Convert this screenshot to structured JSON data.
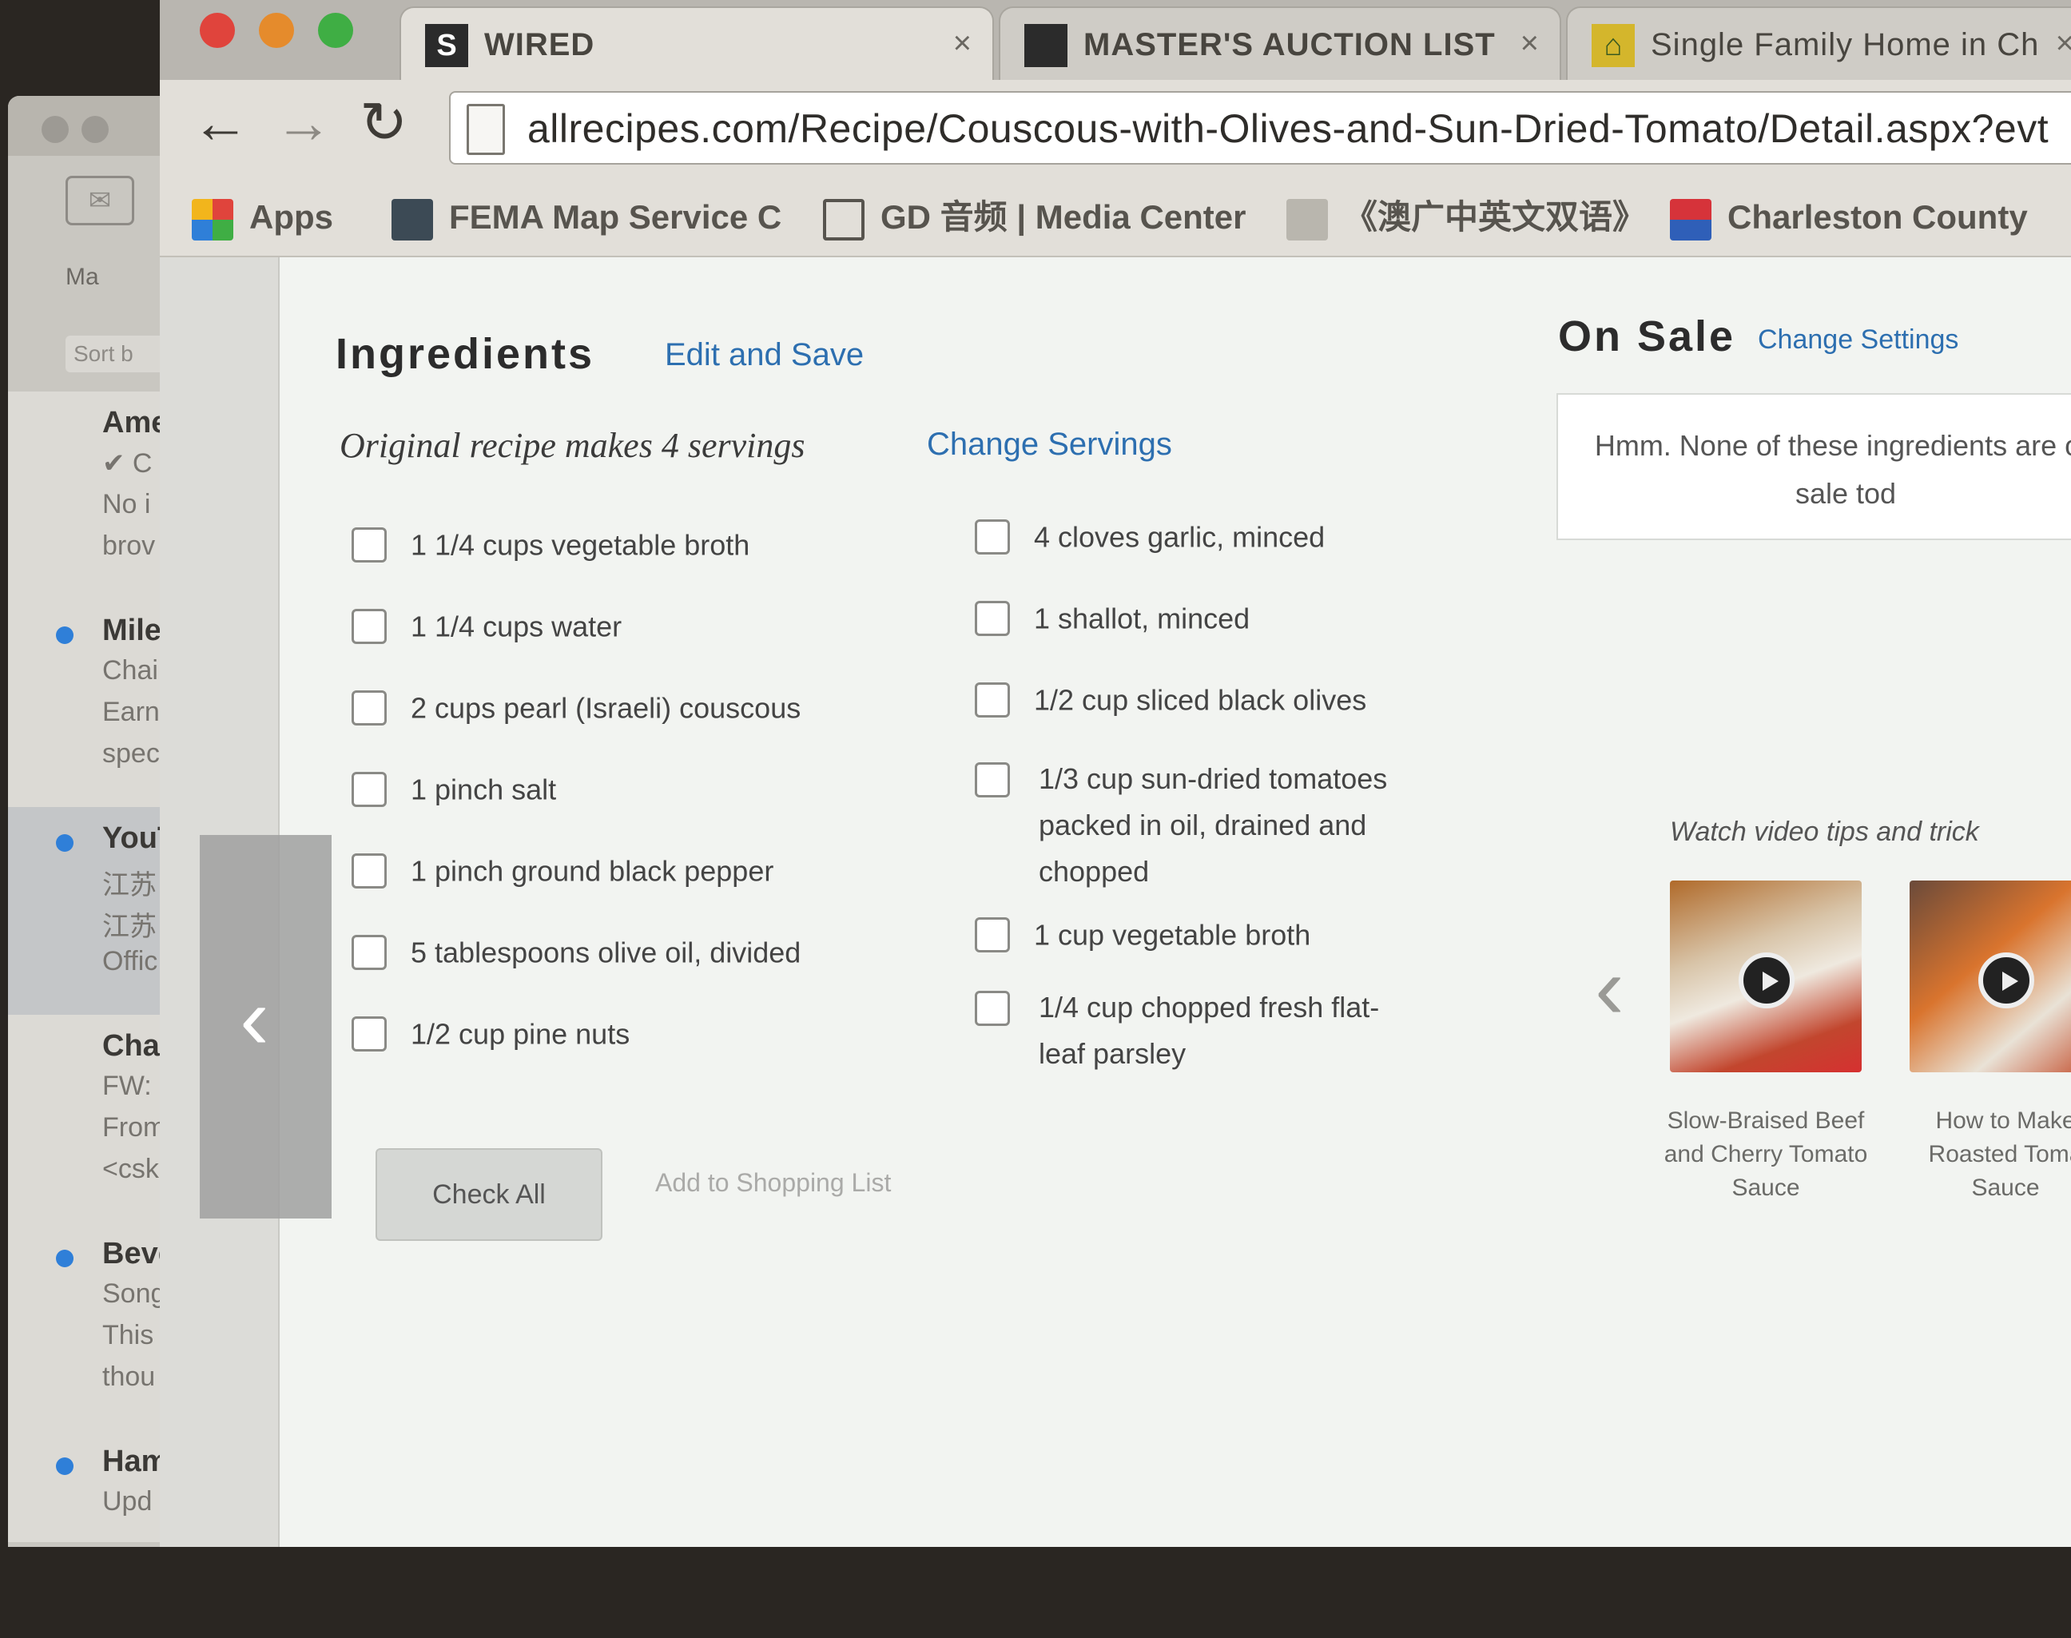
{
  "browser": {
    "tabs": [
      {
        "title": "WIRED",
        "favicon": "wired-favicon",
        "active": true
      },
      {
        "title": "MASTER'S AUCTION LIST",
        "favicon": "sheet-favicon",
        "active": false
      },
      {
        "title": "Single Family Home in Ch",
        "favicon": "house-favicon",
        "active": false
      }
    ],
    "tab_close_glyph": "×",
    "wired_icon_letter": "S",
    "url": "allrecipes.com/Recipe/Couscous-with-Olives-and-Sun-Dried-Tomato/Detail.aspx?evt",
    "bookmarks": [
      {
        "label": "Apps",
        "icon": "apps-grid-icon"
      },
      {
        "label": "FEMA Map Service C",
        "icon": "fema-icon"
      },
      {
        "label": "GD 音频 | Media Center",
        "icon": "media-center-icon"
      },
      {
        "label": "《澳广中英文双语》",
        "icon": "doc-icon"
      },
      {
        "label": "Charleston County",
        "icon": "charleston-icon"
      }
    ]
  },
  "recipe": {
    "ingredients_heading": "Ingredients",
    "edit_save_link": "Edit and Save",
    "servings_text": "Original recipe makes 4 servings",
    "change_servings_link": "Change Servings",
    "ingredients_left": [
      "1 1/4 cups vegetable broth",
      "1 1/4 cups water",
      "2 cups pearl (Israeli) couscous",
      "1 pinch salt",
      "1 pinch ground black pepper",
      "5 tablespoons olive oil, divided",
      "1/2 cup pine nuts"
    ],
    "ingredients_right": [
      "4 cloves garlic, minced",
      "1 shallot, minced",
      "1/2 cup sliced black olives",
      "1/3 cup sun-dried tomatoes packed in oil, drained and chopped",
      "1 cup vegetable broth",
      "1/4 cup chopped fresh flat-leaf parsley"
    ],
    "check_all_button": "Check All",
    "add_to_list_link": "Add to Shopping List"
  },
  "sidebar": {
    "on_sale_heading": "On Sale",
    "change_settings_link": "Change Settings",
    "on_sale_message": "Hmm. None of these ingredients are on sale tod",
    "video_heading": "Watch video tips and trick",
    "videos": [
      {
        "caption": "Slow-Braised Beef and Cherry Tomato Sauce"
      },
      {
        "caption": "How to Make Roasted Toma Sauce"
      }
    ]
  },
  "mail": {
    "mailbox_label": "Ma",
    "sort_label": "Sort b",
    "messages": [
      {
        "sender": "Ame",
        "lines": [
          "✔ C",
          "No i",
          "brov"
        ],
        "unread": false
      },
      {
        "sender": "Mile",
        "lines": [
          "Chai",
          "Earn",
          "spec"
        ],
        "unread": true
      },
      {
        "sender": "YouT",
        "lines": [
          "江苏",
          "江苏",
          "Offic"
        ],
        "unread": true
      },
      {
        "sender": "Char",
        "lines": [
          "FW:",
          "From",
          "<csk"
        ],
        "unread": false
      },
      {
        "sender": "Beve",
        "lines": [
          "Song",
          "This",
          "thou"
        ],
        "unread": true
      },
      {
        "sender": "Ham",
        "lines": [
          "Upd"
        ],
        "unread": true
      }
    ]
  }
}
